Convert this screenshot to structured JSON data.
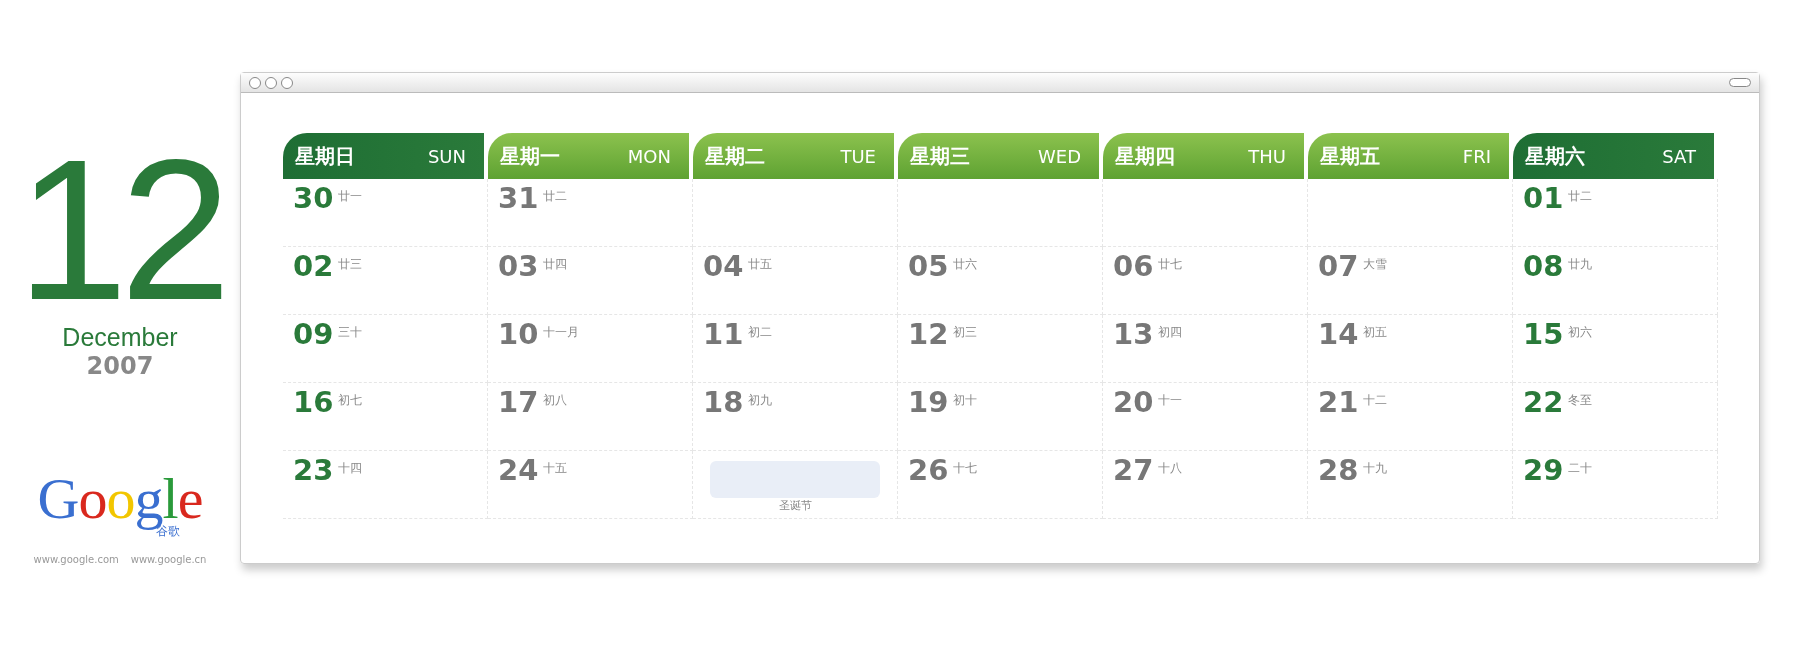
{
  "side": {
    "month_number": "12",
    "month_name": "December",
    "year": "2007",
    "logo": {
      "text": "Google",
      "subtitle": "谷歌",
      "links": [
        "www.google.com",
        "www.google.cn"
      ]
    }
  },
  "calendar": {
    "headers": [
      {
        "zh": "星期日",
        "en": "SUN",
        "kind": "weekend"
      },
      {
        "zh": "星期一",
        "en": "MON",
        "kind": "weekday"
      },
      {
        "zh": "星期二",
        "en": "TUE",
        "kind": "weekday"
      },
      {
        "zh": "星期三",
        "en": "WED",
        "kind": "weekday"
      },
      {
        "zh": "星期四",
        "en": "THU",
        "kind": "weekday"
      },
      {
        "zh": "星期五",
        "en": "FRI",
        "kind": "weekday"
      },
      {
        "zh": "星期六",
        "en": "SAT",
        "kind": "weekend"
      }
    ],
    "weeks": [
      [
        {
          "kind": "weekend",
          "day": "30",
          "lunar": "廿一"
        },
        {
          "kind": "weekday",
          "day": "31",
          "lunar": "廿二"
        },
        {
          "kind": "empty"
        },
        {
          "kind": "empty"
        },
        {
          "kind": "empty"
        },
        {
          "kind": "empty"
        },
        {
          "kind": "weekend",
          "day": "01",
          "lunar": "廿二"
        }
      ],
      [
        {
          "kind": "weekend",
          "day": "02",
          "lunar": "廿三"
        },
        {
          "kind": "weekday",
          "day": "03",
          "lunar": "廿四"
        },
        {
          "kind": "weekday",
          "day": "04",
          "lunar": "廿五"
        },
        {
          "kind": "weekday",
          "day": "05",
          "lunar": "廿六"
        },
        {
          "kind": "weekday",
          "day": "06",
          "lunar": "廿七"
        },
        {
          "kind": "weekday",
          "day": "07",
          "lunar": "大雪"
        },
        {
          "kind": "weekend",
          "day": "08",
          "lunar": "廿九"
        }
      ],
      [
        {
          "kind": "weekend",
          "day": "09",
          "lunar": "三十"
        },
        {
          "kind": "weekday",
          "day": "10",
          "lunar": "十一月"
        },
        {
          "kind": "weekday",
          "day": "11",
          "lunar": "初二"
        },
        {
          "kind": "weekday",
          "day": "12",
          "lunar": "初三"
        },
        {
          "kind": "weekday",
          "day": "13",
          "lunar": "初四"
        },
        {
          "kind": "weekday",
          "day": "14",
          "lunar": "初五"
        },
        {
          "kind": "weekend",
          "day": "15",
          "lunar": "初六"
        }
      ],
      [
        {
          "kind": "weekend",
          "day": "16",
          "lunar": "初七"
        },
        {
          "kind": "weekday",
          "day": "17",
          "lunar": "初八"
        },
        {
          "kind": "weekday",
          "day": "18",
          "lunar": "初九"
        },
        {
          "kind": "weekday",
          "day": "19",
          "lunar": "初十"
        },
        {
          "kind": "weekday",
          "day": "20",
          "lunar": "十一"
        },
        {
          "kind": "weekday",
          "day": "21",
          "lunar": "十二"
        },
        {
          "kind": "weekend",
          "day": "22",
          "lunar": "冬至"
        }
      ],
      [
        {
          "kind": "weekend",
          "day": "23",
          "lunar": "十四"
        },
        {
          "kind": "weekday",
          "day": "24",
          "lunar": "十五"
        },
        {
          "kind": "doodle",
          "caption": "圣诞节"
        },
        {
          "kind": "weekday",
          "day": "26",
          "lunar": "十七"
        },
        {
          "kind": "weekday",
          "day": "27",
          "lunar": "十八"
        },
        {
          "kind": "weekday",
          "day": "28",
          "lunar": "十九"
        },
        {
          "kind": "weekend",
          "day": "29",
          "lunar": "二十"
        }
      ]
    ]
  }
}
